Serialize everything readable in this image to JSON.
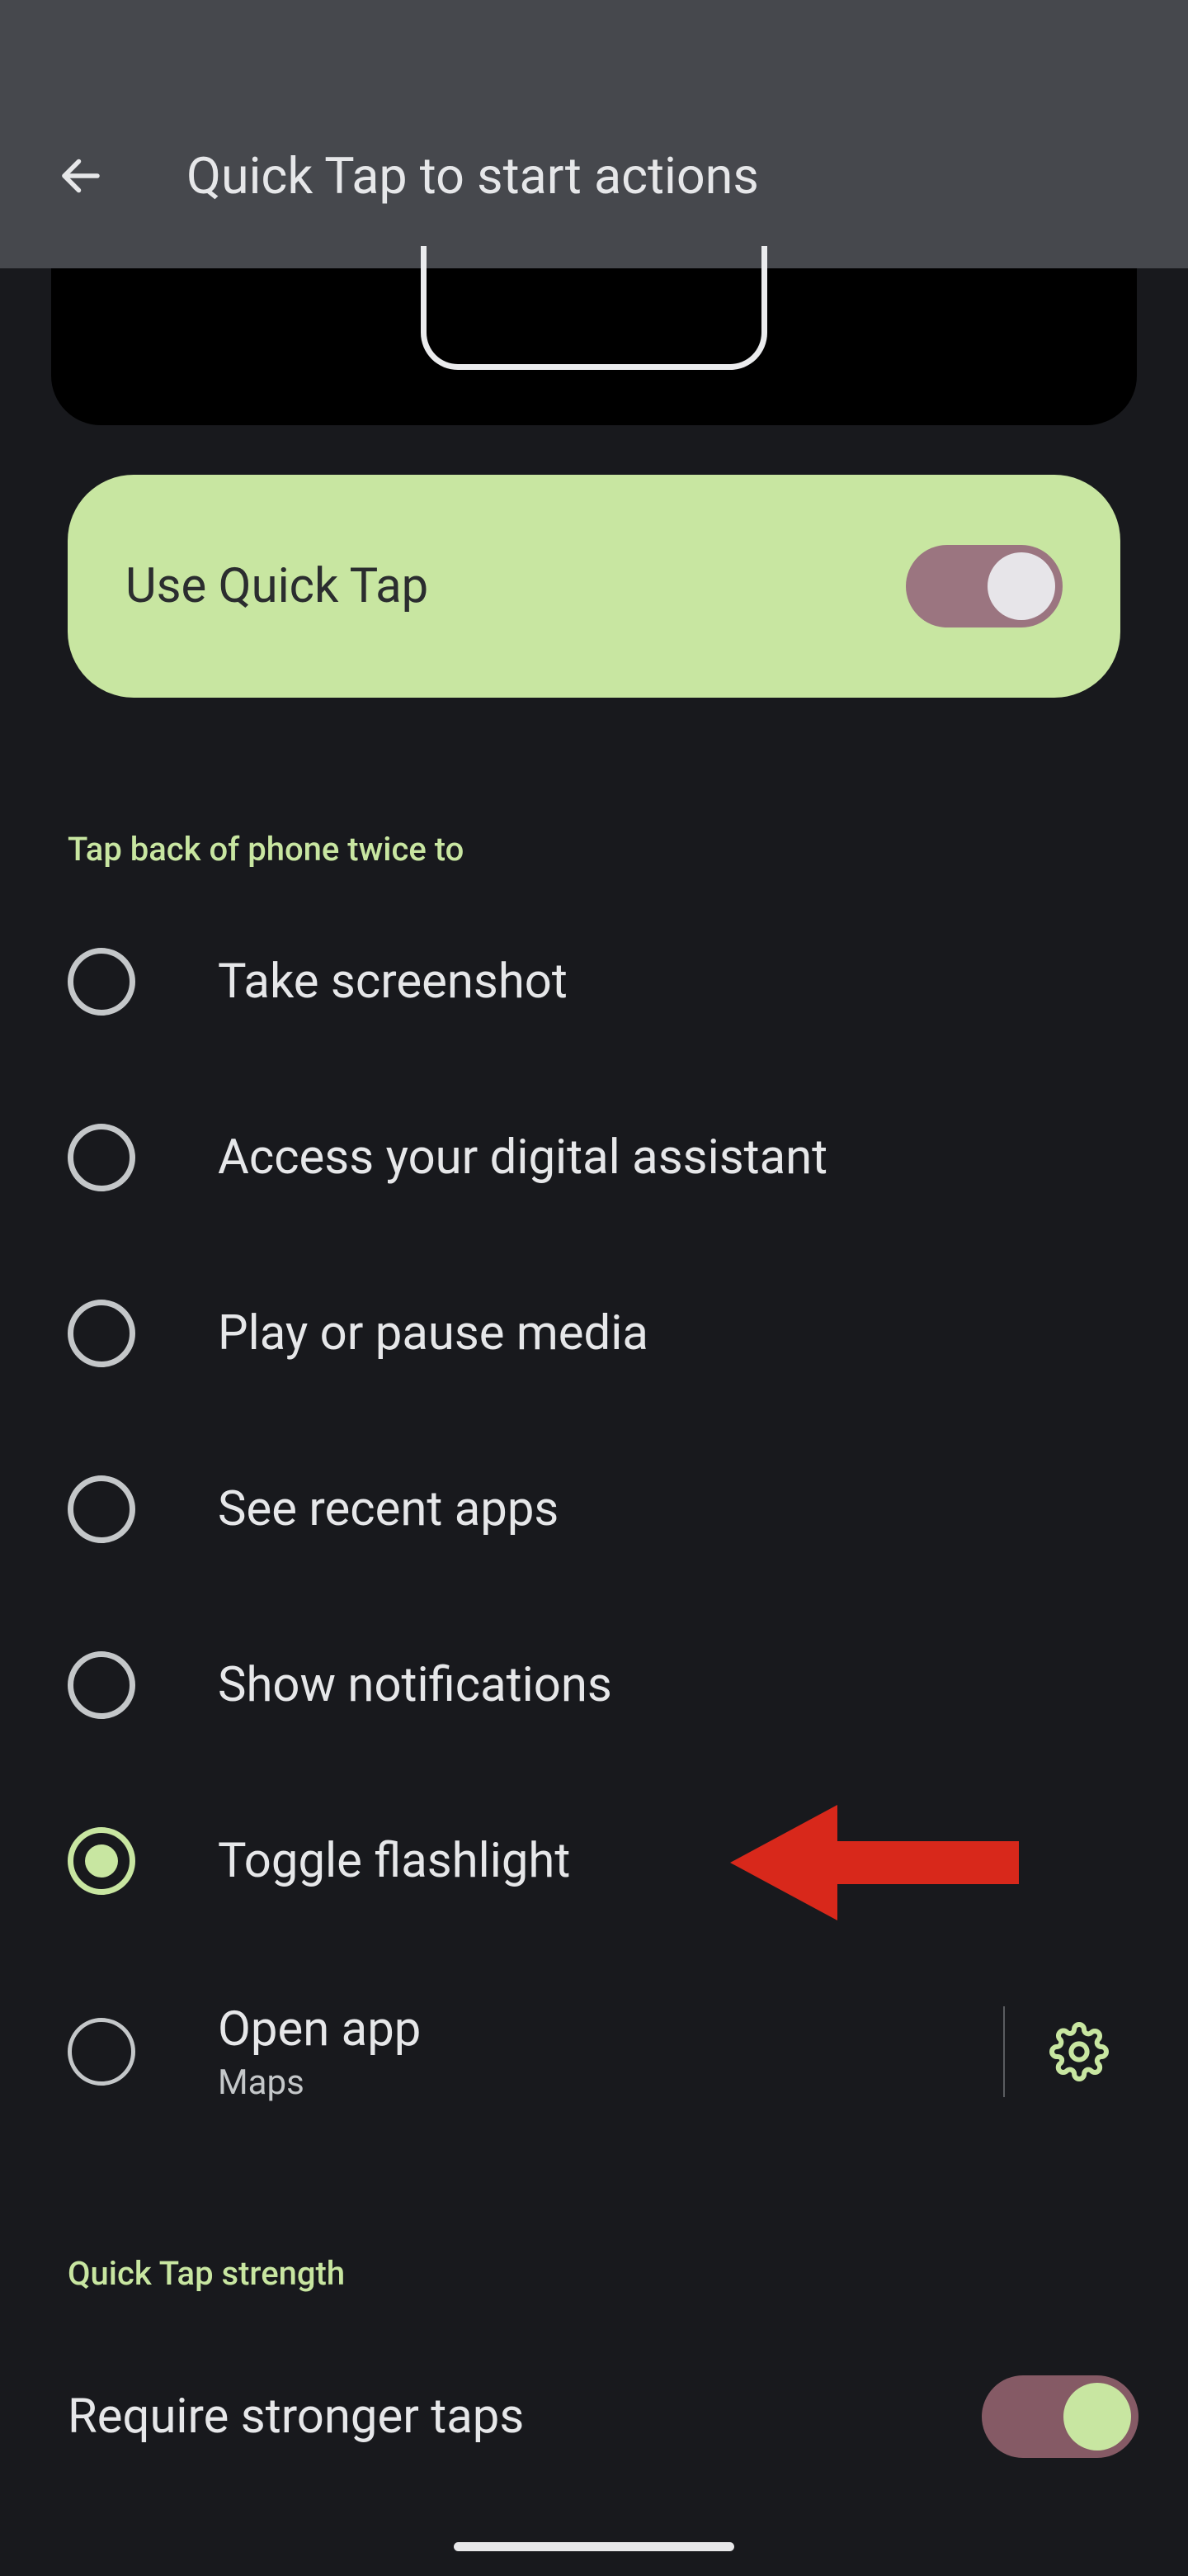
{
  "header": {
    "title": "Quick Tap to start actions"
  },
  "primary": {
    "label": "Use Quick Tap",
    "enabled": true
  },
  "section1": {
    "heading": "Tap back of phone twice to"
  },
  "options": [
    {
      "label": "Take screenshot",
      "selected": false
    },
    {
      "label": "Access your digital assistant",
      "selected": false
    },
    {
      "label": "Play or pause media",
      "selected": false
    },
    {
      "label": "See recent apps",
      "selected": false
    },
    {
      "label": "Show notifications",
      "selected": false
    },
    {
      "label": "Toggle flashlight",
      "selected": true
    },
    {
      "label": "Open app",
      "sub": "Maps",
      "selected": false,
      "has_gear": true
    }
  ],
  "section2": {
    "heading": "Quick Tap strength"
  },
  "stronger": {
    "label": "Require stronger taps",
    "enabled": true
  },
  "annotation": {
    "target_option_index": 5,
    "color": "#d8281b"
  }
}
